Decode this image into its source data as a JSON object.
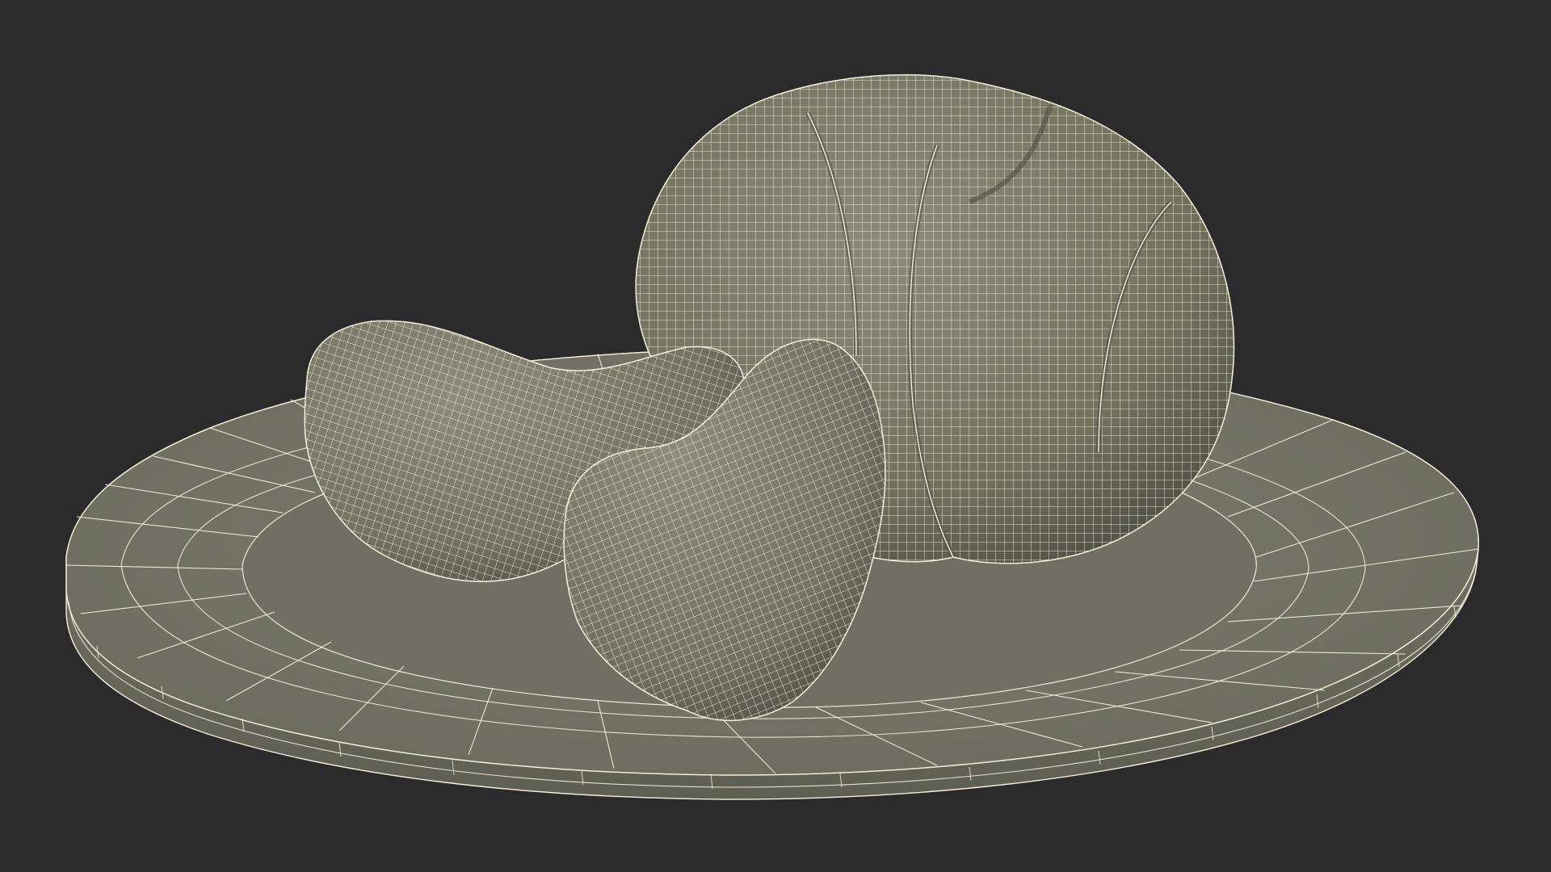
{
  "scene": {
    "background_color": "#2b2b2b",
    "model_surface_color": "#77786a",
    "model_shadow_color": "#4a4b40",
    "model_highlight_color": "#8f917f",
    "wireframe_color": "#f3efdc",
    "objects": [
      "plate",
      "whole-peeled-mandarin",
      "mandarin-segment-left",
      "mandarin-segment-front"
    ]
  }
}
